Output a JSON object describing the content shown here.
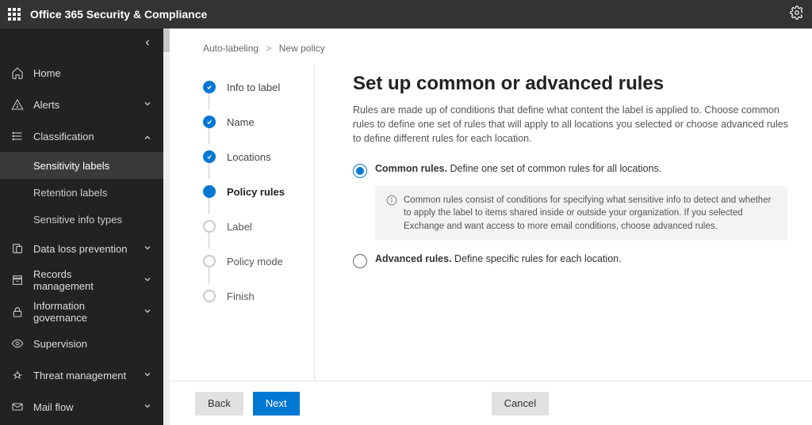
{
  "topbar": {
    "app_title": "Office 365 Security & Compliance"
  },
  "sidebar": {
    "items": [
      {
        "label": "Home",
        "expandable": false
      },
      {
        "label": "Alerts",
        "expandable": true
      },
      {
        "label": "Classification",
        "expandable": true,
        "expanded": true,
        "children": [
          {
            "label": "Sensitivity labels",
            "active": true
          },
          {
            "label": "Retention labels"
          },
          {
            "label": "Sensitive info types"
          }
        ]
      },
      {
        "label": "Data loss prevention",
        "expandable": true
      },
      {
        "label": "Records management",
        "expandable": true
      },
      {
        "label": "Information governance",
        "expandable": true
      },
      {
        "label": "Supervision",
        "expandable": false
      },
      {
        "label": "Threat management",
        "expandable": true
      },
      {
        "label": "Mail flow",
        "expandable": true
      }
    ]
  },
  "breadcrumb": {
    "parent": "Auto-labeling",
    "current": "New policy"
  },
  "steps": [
    {
      "label": "Info to label",
      "state": "done"
    },
    {
      "label": "Name",
      "state": "done"
    },
    {
      "label": "Locations",
      "state": "done"
    },
    {
      "label": "Policy rules",
      "state": "current"
    },
    {
      "label": "Label",
      "state": "todo"
    },
    {
      "label": "Policy mode",
      "state": "todo"
    },
    {
      "label": "Finish",
      "state": "todo"
    }
  ],
  "form": {
    "heading": "Set up common or advanced rules",
    "description": "Rules are made up of conditions that define what content the label is applied to. Choose common rules to define one set of rules that will apply to all locations you selected or choose advanced rules to define different rules for each location.",
    "options": [
      {
        "title": "Common rules.",
        "desc": " Define one set of common rules for all locations.",
        "selected": true
      },
      {
        "title": "Advanced rules.",
        "desc": " Define specific rules for each location.",
        "selected": false
      }
    ],
    "info_callout": "Common rules consist of conditions for specifying what sensitive info to detect and whether to apply the label to items shared inside or outside your organization. If you selected Exchange and want access to more email conditions, choose advanced rules."
  },
  "footer": {
    "back": "Back",
    "next": "Next",
    "cancel": "Cancel"
  }
}
